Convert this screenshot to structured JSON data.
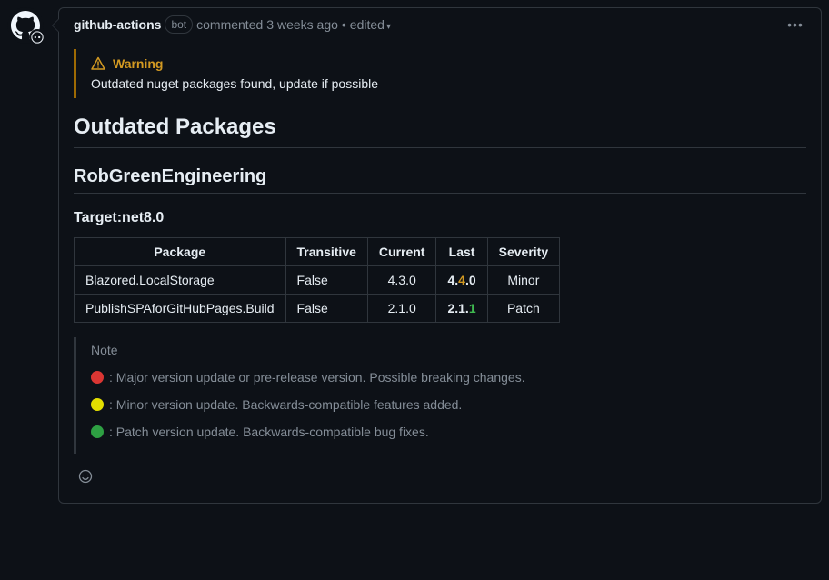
{
  "header": {
    "author": "github-actions",
    "bot_label": "bot",
    "action": "commented",
    "time": "3 weeks ago",
    "edited": "edited"
  },
  "alert": {
    "title": "Warning",
    "body": "Outdated nuget packages found, update if possible"
  },
  "headings": {
    "main": "Outdated Packages",
    "project": "RobGreenEngineering",
    "target": "Target:net8.0"
  },
  "table": {
    "cols": [
      "Package",
      "Transitive",
      "Current",
      "Last",
      "Severity"
    ],
    "rows": [
      {
        "package": "Blazored.LocalStorage",
        "transitive": "False",
        "current": "4.3.0",
        "last_prefix": "4.",
        "last_hl": "4",
        "last_suffix": ".0",
        "hl_class": "hl-minor",
        "severity": "Minor"
      },
      {
        "package": "PublishSPAforGitHubPages.Build",
        "transitive": "False",
        "current": "2.1.0",
        "last_prefix": "2.1.",
        "last_hl": "1",
        "last_suffix": "",
        "hl_class": "hl-patch",
        "severity": "Patch"
      }
    ]
  },
  "note": {
    "title": "Note",
    "lines": [
      {
        "color": "red",
        "text": ": Major version update or pre-release version. Possible breaking changes."
      },
      {
        "color": "yellow",
        "text": ": Minor version update. Backwards-compatible features added."
      },
      {
        "color": "green",
        "text": ": Patch version update. Backwards-compatible bug fixes."
      }
    ]
  }
}
